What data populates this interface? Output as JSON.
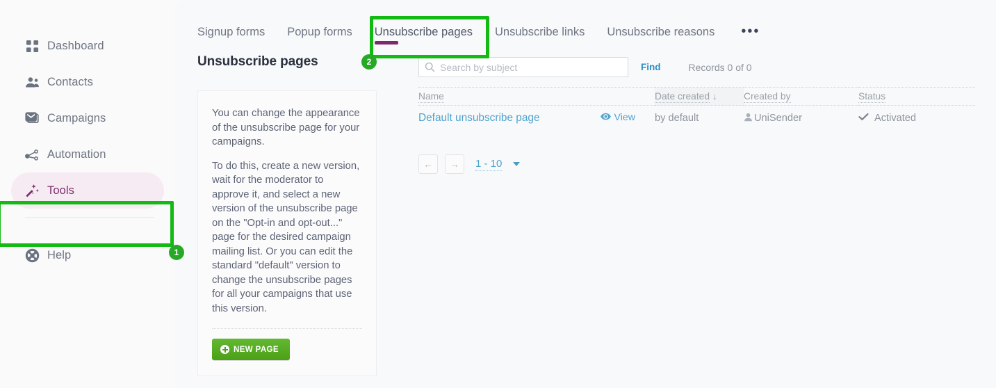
{
  "sidebar": {
    "items": [
      {
        "label": "Dashboard",
        "icon": "grid-icon",
        "active": false
      },
      {
        "label": "Contacts",
        "icon": "people-icon",
        "active": false
      },
      {
        "label": "Campaigns",
        "icon": "envelope-icon",
        "active": false
      },
      {
        "label": "Automation",
        "icon": "share-nodes-icon",
        "active": false
      },
      {
        "label": "Tools",
        "icon": "magic-wand-icon",
        "active": true
      },
      {
        "label": "Help",
        "icon": "life-ring-icon",
        "active": false
      }
    ]
  },
  "tabs": [
    {
      "label": "Signup forms",
      "active": false
    },
    {
      "label": "Popup forms",
      "active": false
    },
    {
      "label": "Unsubscribe pages",
      "active": true
    },
    {
      "label": "Unsubscribe links",
      "active": false
    },
    {
      "label": "Unsubscribe reasons",
      "active": false
    }
  ],
  "tabs_more_label": "•••",
  "page": {
    "title": "Unsubscribe pages"
  },
  "info_card": {
    "paragraphs": [
      "You can change the appearance of the unsubscribe page for your campaigns.",
      "To do this, create a new version, wait for the moderator to approve it, and select a new version of the unsubscribe page on the \"Opt-in and opt-out...\" page for the desired campaign mailing list. Or you can edit the standard \"default\" version to change the unsubscribe pages for all your campaigns that use this version."
    ],
    "new_page_button": "NEW PAGE"
  },
  "search": {
    "placeholder": "Search by subject",
    "value": "",
    "find_label": "Find",
    "records_label": "Records 0 of 0"
  },
  "table": {
    "columns": [
      {
        "label": "Name",
        "sorted": false
      },
      {
        "label": "Date created",
        "sorted": true,
        "sort_arrow": "↓"
      },
      {
        "label": "Created by",
        "sorted": false
      },
      {
        "label": "Status",
        "sorted": false
      }
    ],
    "rows": [
      {
        "name": "Default unsubscribe page",
        "view_label": "View",
        "date_created": "by default",
        "created_by": "UniSender",
        "status": "Activated"
      }
    ]
  },
  "pagination": {
    "prev_label": "←",
    "next_label": "→",
    "range_label": "1 - 10"
  },
  "annotations": [
    {
      "id": "1",
      "badge": "1",
      "target": "sidebar-item-tools"
    },
    {
      "id": "2",
      "badge": "2",
      "target": "tab-unsubscribe-pages"
    }
  ],
  "colors": {
    "accent_purple": "#7c2a6c",
    "link_blue": "#4fa3cf",
    "find_blue": "#2b8dc4",
    "button_green": "#4ca017",
    "annotation_green": "#14ba14",
    "badge_green": "#27a927"
  }
}
